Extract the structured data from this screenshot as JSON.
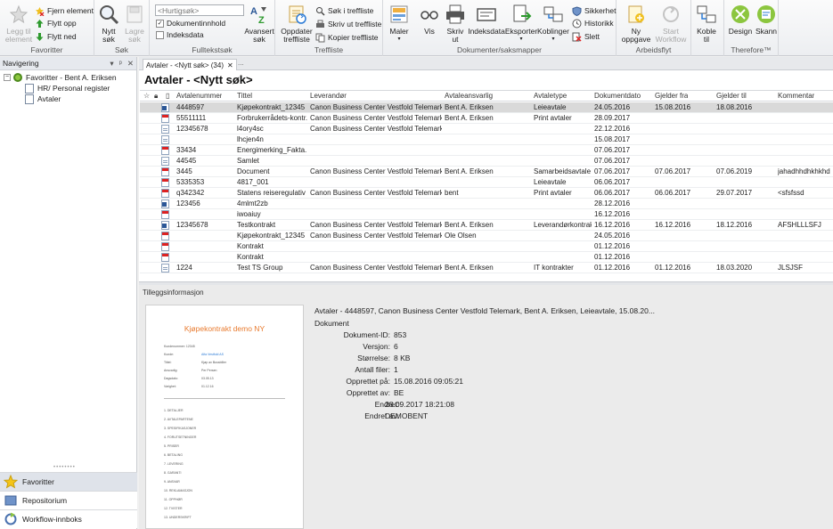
{
  "ribbon": {
    "groups": [
      {
        "label": "Favoritter"
      },
      {
        "label": "Søk"
      },
      {
        "label": "Fulltekstsøk"
      },
      {
        "label": "Treffliste"
      },
      {
        "label": "Dokumenter/saksmapper"
      },
      {
        "label": "Arbeidsflyt"
      },
      {
        "label": "Therefore™"
      }
    ],
    "fav": {
      "add": "Legg til element",
      "remove": "Fjern element",
      "up": "Flytt opp",
      "down": "Flytt ned"
    },
    "search": {
      "new": "Nytt søk",
      "save": "Lagre søk"
    },
    "fulltext": {
      "placeholder": "<Hurtigsøk>",
      "doc_content": "Dokumentinnhold",
      "index_data": "Indeksdata",
      "advanced": "Avansert søk"
    },
    "hitlist": {
      "refresh": "Oppdater treffliste",
      "search_in": "Søk i treffliste",
      "print": "Skriv ut treffliste",
      "copy": "Kopier treffliste"
    },
    "docs": {
      "templates": "Maler",
      "view": "Vis",
      "print": "Skriv ut",
      "indexdata": "Indeksdata",
      "export": "Eksporter",
      "links": "Koblinger",
      "security": "Sikkerhet",
      "history": "Historikk",
      "delete": "Slett"
    },
    "workflow": {
      "new_task": "Ny oppgave",
      "start": "Start Workflow"
    },
    "therefore": {
      "link": "Koble til",
      "design": "Design",
      "scan": "Skann"
    }
  },
  "nav": {
    "header": "Navigering",
    "controls": {
      "dropdown": "▾",
      "pin": "ᵖ",
      "close": "✕"
    },
    "tree": {
      "root": "Favoritter - Bent A. Eriksen",
      "child1": "HR/ Personal register",
      "child2": "Avtaler"
    },
    "bottom": {
      "favorites": "Favoritter",
      "repository": "Repositorium",
      "workflow": "Workflow-innboks"
    }
  },
  "tab": {
    "label": "Avtaler - <Nytt søk> (34)",
    "close": "✕",
    "more": "..."
  },
  "page_title": "Avtaler - <Nytt søk>",
  "grid": {
    "columns": [
      "Avtalenummer",
      "Tittel",
      "Leverandør",
      "Avtaleansvarlig",
      "Avtaletype",
      "Dokumentdato",
      "Gjelder fra",
      "Gjelder til",
      "Kommentar"
    ],
    "rows": [
      {
        "icon": "word",
        "c": [
          "4448597",
          "Kjøpekontrakt_12345",
          "Canon Business Center Vestfold Telemark",
          "Bent A. Eriksen",
          "Leieavtale",
          "24.05.2016",
          "15.08.2016",
          "18.08.2016",
          ""
        ]
      },
      {
        "icon": "pdf",
        "c": [
          "55511111",
          "Forbrukerrådets-kontr...",
          "Canon Business Center Vestfold Telemark",
          "Bent A. Eriksen",
          "Print avtaler",
          "28.09.2017",
          "",
          "",
          ""
        ]
      },
      {
        "icon": "doc",
        "c": [
          "12345678",
          "l4ory4sc",
          "Canon Business Center Vestfold Telemark",
          "",
          "",
          "22.12.2016",
          "",
          "",
          ""
        ]
      },
      {
        "icon": "doc",
        "c": [
          "",
          "lhcjen4n",
          "",
          "",
          "",
          "15.08.2017",
          "",
          "",
          ""
        ]
      },
      {
        "icon": "pdf",
        "c": [
          "33434",
          "Energimerking_Fakta...",
          "",
          "",
          "",
          "07.06.2017",
          "",
          "",
          ""
        ]
      },
      {
        "icon": "doc",
        "c": [
          "44545",
          "Samlet",
          "",
          "",
          "",
          "07.06.2017",
          "",
          "",
          ""
        ]
      },
      {
        "icon": "pdf",
        "c": [
          "3445",
          "Document",
          "Canon Business Center Vestfold Telemark",
          "Bent A. Eriksen",
          "Samarbeidsavtale",
          "07.06.2017",
          "07.06.2017",
          "07.06.2019",
          "jahadhhdhkhkhd"
        ]
      },
      {
        "icon": "pdf",
        "c": [
          "5335353",
          "4817_001",
          "",
          "",
          "Leieavtale",
          "06.06.2017",
          "",
          "",
          ""
        ]
      },
      {
        "icon": "pdf",
        "c": [
          "q342342",
          "Statens reiseregulativ",
          "Canon Business Center Vestfold Telemark",
          "bent",
          "Print avtaler",
          "06.06.2017",
          "06.06.2017",
          "29.07.2017",
          "<sfsfssd"
        ]
      },
      {
        "icon": "word",
        "c": [
          "123456",
          "4mlmt2zb",
          "",
          "",
          "",
          "28.12.2016",
          "",
          "",
          ""
        ]
      },
      {
        "icon": "pdf",
        "c": [
          "",
          "iwoaiuy",
          "",
          "",
          "",
          "16.12.2016",
          "",
          "",
          ""
        ]
      },
      {
        "icon": "word",
        "c": [
          "12345678",
          "Testkontrakt",
          "Canon Business Center Vestfold Telemark",
          "Bent A. Eriksen",
          "Leverandørkontrakt",
          "16.12.2016",
          "16.12.2016",
          "18.12.2016",
          "AFSHLLLSFJ"
        ]
      },
      {
        "icon": "pdf",
        "c": [
          "",
          "Kjøpekontrakt_12345",
          "Canon Business Center Vestfold Telemark",
          "Ole Olsen",
          "",
          "24.05.2016",
          "",
          "",
          ""
        ]
      },
      {
        "icon": "pdf",
        "c": [
          "",
          "Kontrakt",
          "",
          "",
          "",
          "01.12.2016",
          "",
          "",
          ""
        ]
      },
      {
        "icon": "pdf",
        "c": [
          "",
          "Kontrakt",
          "",
          "",
          "",
          "01.12.2016",
          "",
          "",
          ""
        ]
      },
      {
        "icon": "doc",
        "c": [
          "1224",
          "Test TS Group",
          "Canon Business Center Vestfold Telemark",
          "Bent A. Eriksen",
          "IT kontrakter",
          "01.12.2016",
          "01.12.2016",
          "18.03.2020",
          "JLSJSF"
        ]
      }
    ]
  },
  "info": {
    "label": "Tilleggsinformasjon",
    "preview": {
      "title": "Kjøpekontrakt demo NY",
      "lines": [
        "Kundenummer: 12345",
        "Kunde:",
        "Tittel:",
        "Ansvarlig:",
        "Dagsdato:",
        "Varighet:"
      ],
      "values": [
        "",
        "Alfa Vestfold AS",
        "Kjøp av Bussbiller",
        "Per Persen",
        "03.05.13",
        "01.12.16"
      ],
      "list": [
        "1. DETALJER",
        "2. AVTALEPARTENE",
        "3. SPESIFIKASJONER",
        "4. FORUTSETNINGER",
        "5. PRISER",
        "6. BETALING",
        "7. LEVERING",
        "8. GARANTI",
        "9. ANSVAR",
        "10. REKLAMASJON",
        "11. OPPHØR",
        "12. TVISTER",
        "13. UNDERSKRIFT"
      ]
    },
    "summary": "Avtaler - 4448597, Canon Business Center Vestfold Telemark, Bent A. Eriksen, Leieavtale, 15.08.20...",
    "type": "Dokument",
    "fields": [
      {
        "label": "Dokument-ID:",
        "value": "853"
      },
      {
        "label": "Versjon:",
        "value": "6"
      },
      {
        "label": "Størrelse:",
        "value": "8 KB"
      },
      {
        "label": "Antall filer:",
        "value": "1"
      },
      {
        "label": "Opprettet på:",
        "value": "15.08.2016 09:05:21"
      },
      {
        "label": "Opprettet av:",
        "value": "BE"
      },
      {
        "label": "Endret:",
        "value": "28.09.2017 18:21:08"
      },
      {
        "label": "Endret av:",
        "value": "DEMOBENT"
      }
    ]
  }
}
